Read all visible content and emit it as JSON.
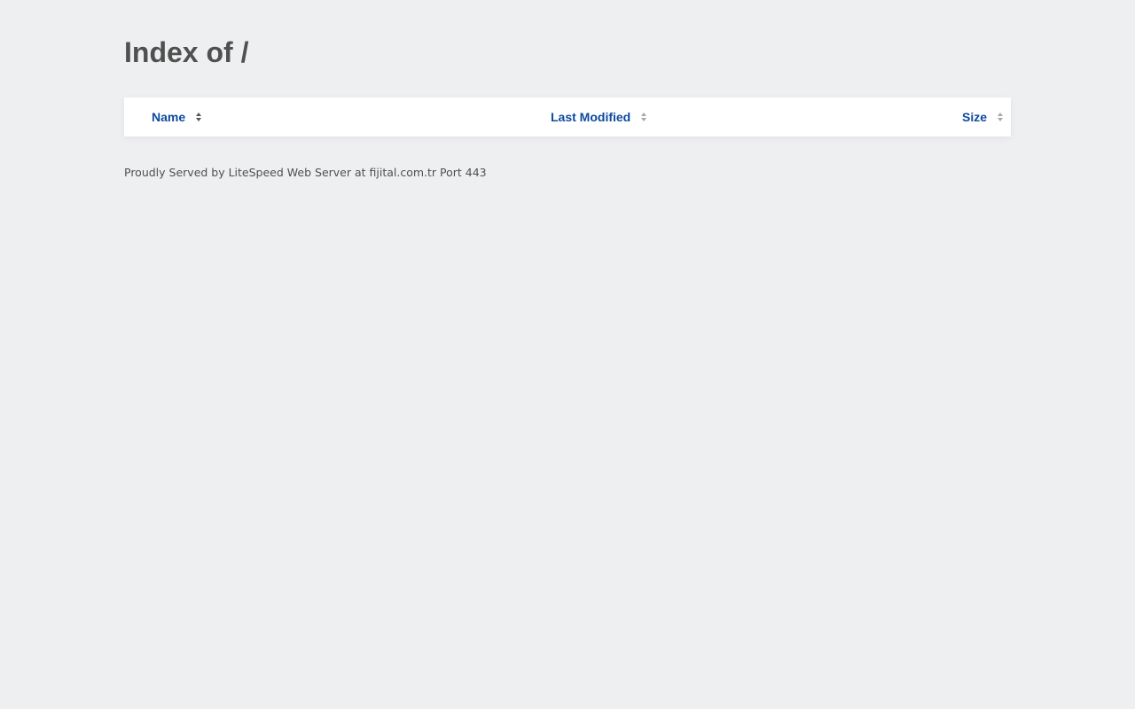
{
  "page": {
    "title": "Index of /"
  },
  "listing": {
    "columns": {
      "name": "Name",
      "last_modified": "Last Modified",
      "size": "Size"
    },
    "icons": {
      "sort": "sort-arrows-icon"
    }
  },
  "footer": {
    "text": "Proudly Served by LiteSpeed Web Server at fijital.com.tr Port 443"
  },
  "colors": {
    "background": "#eeeff1",
    "link": "#0c4a9e",
    "text": "#505050",
    "panel": "#ffffff"
  }
}
